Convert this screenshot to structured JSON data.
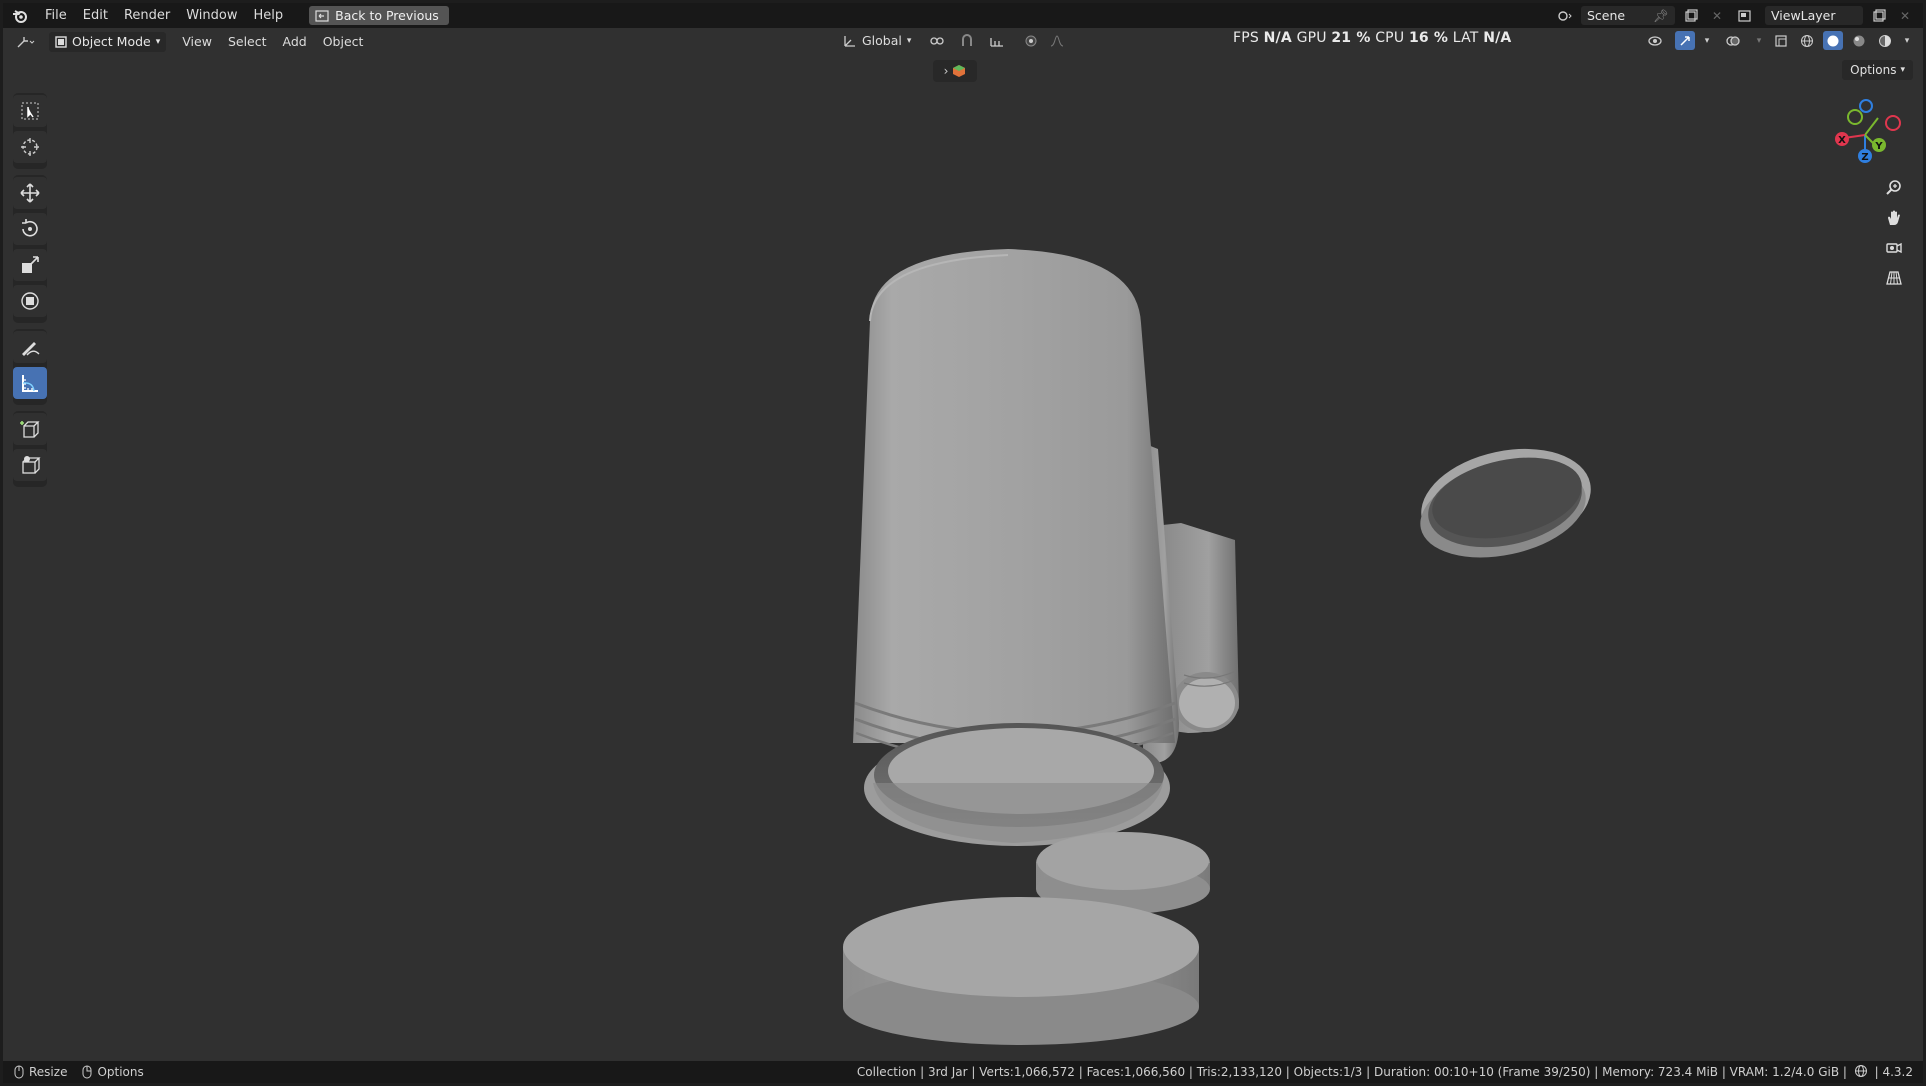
{
  "menu": {
    "file": "File",
    "edit": "Edit",
    "render": "Render",
    "window": "Window",
    "help": "Help",
    "back_button": "Back to Previous"
  },
  "top_right": {
    "scene_label": "Scene",
    "view_layer_label": "ViewLayer"
  },
  "header": {
    "mode": "Object Mode",
    "view": "View",
    "select": "Select",
    "add": "Add",
    "object": "Object",
    "transform_orientation": "Global"
  },
  "perf": {
    "fps_label": "FPS",
    "fps_value": "N/A",
    "gpu_label": "GPU",
    "gpu_value": "21 %",
    "cpu_label": "CPU",
    "cpu_value": "16 %",
    "lat_label": "LAT",
    "lat_value": "N/A"
  },
  "viewport": {
    "options_label": "Options"
  },
  "gizmo": {
    "x": "X",
    "y": "Y",
    "z": "Z"
  },
  "status": {
    "resize": "Resize",
    "options": "Options",
    "info": "Collection | 3rd Jar | Verts:1,066,572 | Faces:1,066,560 | Tris:2,133,120 | Objects:1/3 | Duration: 00:10+10 (Frame 39/250) | Memory: 723.4 MiB | VRAM: 1.2/4.0 GiB |",
    "version": "4.3.2"
  },
  "colors": {
    "accent": "#4772b3",
    "x_axis": "#e0364e",
    "y_axis": "#7ab82e",
    "z_axis": "#2f7fe0"
  }
}
